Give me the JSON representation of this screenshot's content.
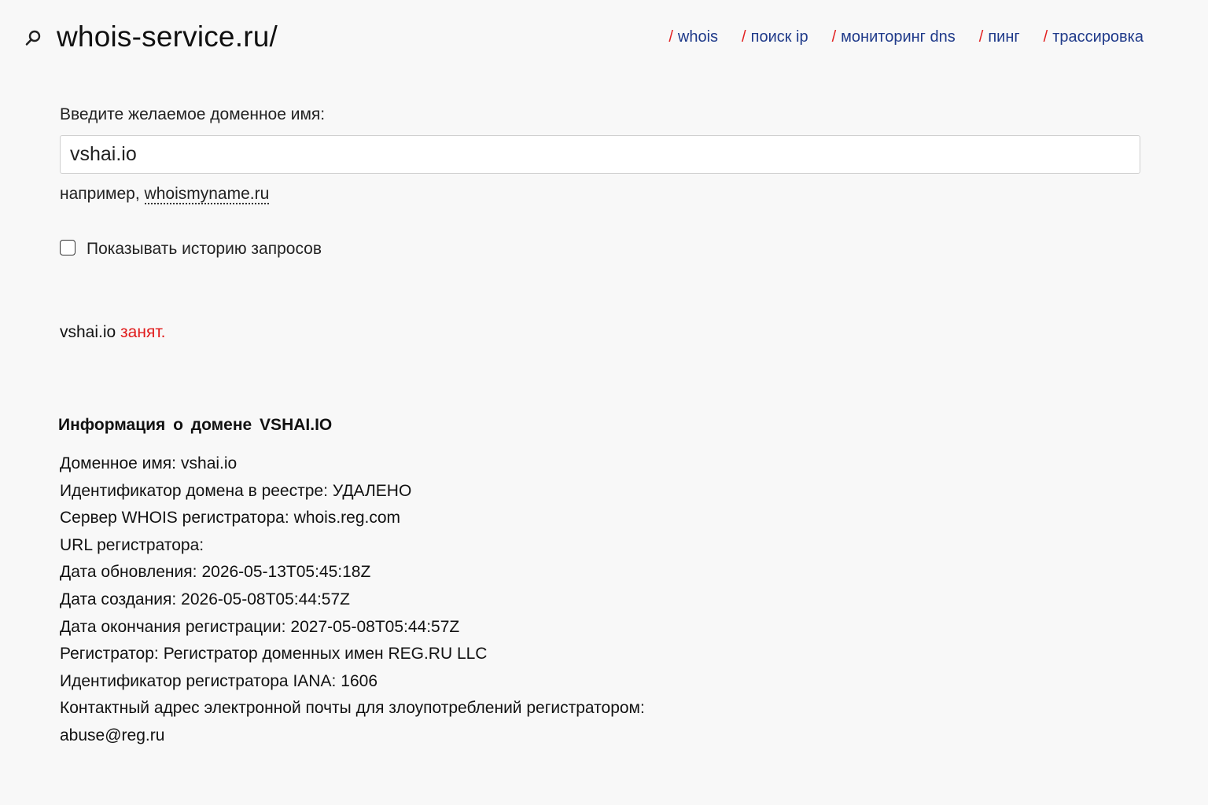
{
  "header": {
    "logo": "whois-service.ru/",
    "search_icon": "search-icon",
    "nav": [
      {
        "slash": "/",
        "label": "whois"
      },
      {
        "slash": "/",
        "label": "поиск ip"
      },
      {
        "slash": "/",
        "label": "мониторинг dns"
      },
      {
        "slash": "/",
        "label": "пинг"
      },
      {
        "slash": "/",
        "label": "трассировка"
      }
    ]
  },
  "form": {
    "label": "Введите желаемое доменное имя:",
    "value": "vshai.io",
    "example_prefix": "например,",
    "example_link": "whoismyname.ru",
    "history_label": "Показывать историю запросов",
    "history_checked": false
  },
  "result": {
    "domain": "vshai.io",
    "status": "занят."
  },
  "info": {
    "title": "Информация о домене VSHAI.IO",
    "rows": [
      {
        "label": "Доменное имя:",
        "value": "vshai.io"
      },
      {
        "label": "Идентификатор домена в реестре:",
        "value": "УДАЛЕНО"
      },
      {
        "label": "Сервер WHOIS регистратора:",
        "value": "whois.reg.com"
      },
      {
        "label": "URL регистратора:",
        "value": ""
      },
      {
        "label": "Дата обновления:",
        "value": "2026-05-13T05:45:18Z"
      },
      {
        "label": "Дата создания:",
        "value": "2026-05-08T05:44:57Z"
      },
      {
        "label": "Дата окончания регистрации:",
        "value": "2027-05-08T05:44:57Z"
      },
      {
        "label": "Регистратор:",
        "value": "Регистратор доменных имен REG.RU LLC"
      },
      {
        "label": "Идентификатор регистратора IANA:",
        "value": "1606"
      },
      {
        "label": "Контактный адрес электронной почты для злоупотреблений регистратором:",
        "value": ""
      },
      {
        "label": "abuse@reg.ru",
        "value": ""
      }
    ]
  },
  "colors": {
    "nav_link": "#1f3a8a",
    "slash": "#e22020",
    "status_taken": "#e01b1b",
    "background": "#f8f8f8"
  }
}
